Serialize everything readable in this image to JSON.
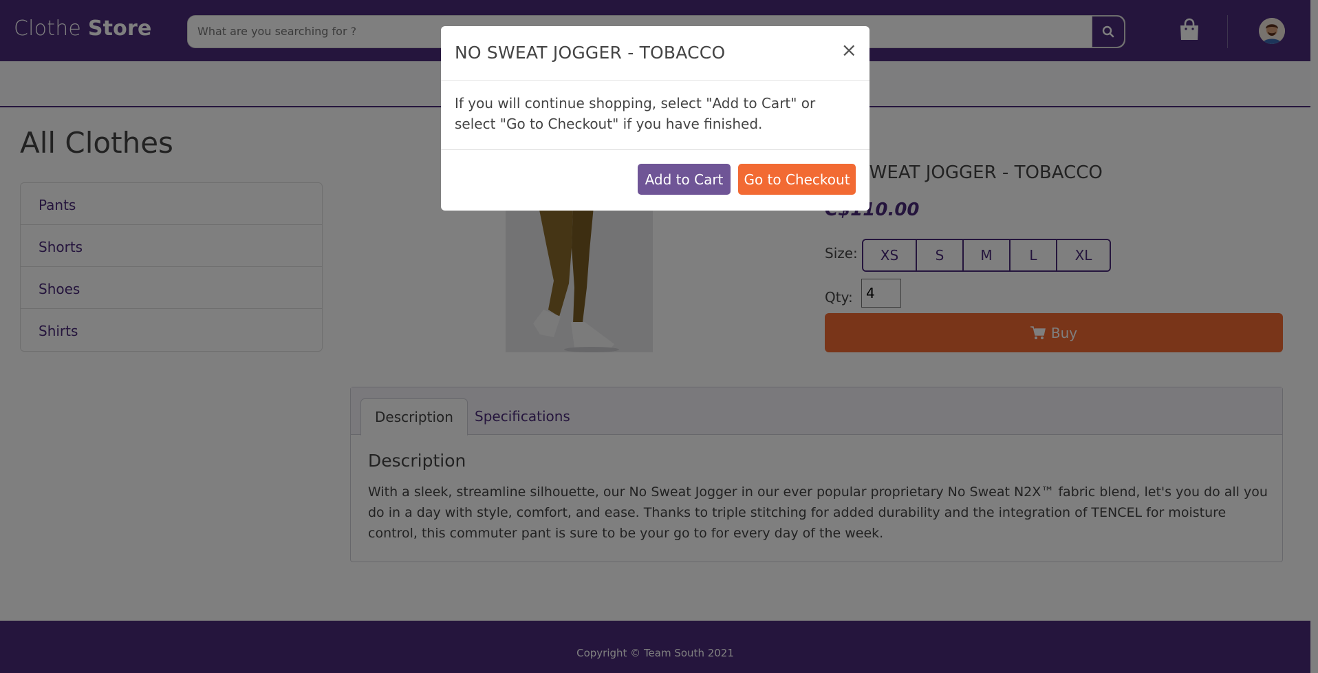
{
  "header": {
    "brand_light": "Clothe",
    "brand_bold": "Store",
    "search_placeholder": "What are you searching for ?",
    "icons": {
      "search": "search-icon",
      "cart": "shopping-bag-icon",
      "profile": "avatar"
    }
  },
  "sidebar": {
    "title": "All Clothes",
    "categories": [
      {
        "label": "Pants"
      },
      {
        "label": "Shorts"
      },
      {
        "label": "Shoes"
      },
      {
        "label": "Shirts"
      }
    ]
  },
  "product": {
    "name": "NO SWEAT JOGGER - TOBACCO",
    "price": "C$110.00",
    "size_label": "Size:",
    "sizes": [
      "XS",
      "S",
      "M",
      "L",
      "XL"
    ],
    "qty_label": "Qty:",
    "qty_value": "4",
    "buy_label": "Buy"
  },
  "tabs": {
    "items": [
      {
        "label": "Description",
        "active": true
      },
      {
        "label": "Specifications",
        "active": false
      }
    ],
    "description_title": "Description",
    "description_text": "With a sleek, streamline silhouette, our No Sweat Jogger in our ever popular proprietary No Sweat N2X™ fabric blend, let's you do all you do in a day with style, comfort, and ease. Thanks to triple stitching for added durability and the integration of TENCEL for moisture control, this commuter pant is sure to be your go to for every day of the week."
  },
  "footer": {
    "copyright": "Copyright © Team South 2021"
  },
  "modal": {
    "title": "NO SWEAT JOGGER - TOBACCO",
    "close": "×",
    "body": "If you will continue shopping, select \"Add to Cart\" or select \"Go to Checkout\" if you have finished.",
    "add_to_cart": "Add to Cart",
    "go_to_checkout": "Go to Checkout"
  },
  "colors": {
    "brand_purple": "#4a2a7a",
    "accent_orange": "#f26a33",
    "button_purple": "#6f5596"
  }
}
